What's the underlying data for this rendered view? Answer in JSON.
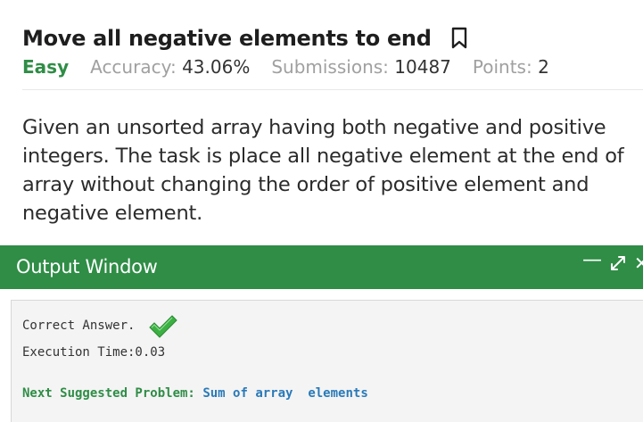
{
  "problem": {
    "title": "Move all negative elements to end",
    "difficulty": "Easy",
    "accuracy_label": "Accuracy:",
    "accuracy_value": "43.06%",
    "submissions_label": "Submissions:",
    "submissions_value": "10487",
    "points_label": "Points:",
    "points_value": "2",
    "description": "Given an unsorted array having both negative and positive integers. The task is place all negative element at the end of array without changing the order of positive element and negative element."
  },
  "output_window": {
    "title": "Output Window",
    "result_text": "Correct Answer.",
    "execution_time": "Execution Time:0.03",
    "next_label": "Next Suggested Problem:",
    "next_problem": "Sum of array  elements"
  },
  "colors": {
    "brand_green": "#2f8d46",
    "link_blue": "#2a7ab8",
    "check_green": "#3cb043"
  },
  "icons": [
    "bookmark-icon",
    "minimize-icon",
    "expand-icon",
    "close-icon",
    "checkmark-icon"
  ]
}
